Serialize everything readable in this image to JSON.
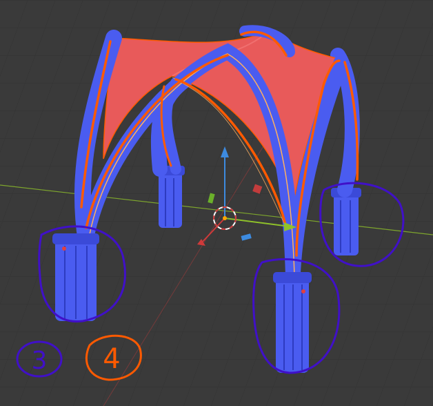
{
  "viewport": {
    "background": "#3a3a3a",
    "grid_color": "#2f2f2f"
  },
  "colors": {
    "column_blue": "#4a5cf0",
    "column_blue_dark": "#2d3bc0",
    "vault_red": "#e85a5a",
    "outline_orange": "#ff5a00",
    "edge_highlight": "#ffb060",
    "axis_x": "#8fc12a",
    "axis_y": "#c23c3c",
    "gizmo_up": "#3d8be0",
    "annotation_purple": "#4010c8",
    "annotation_orange": "#ff5a00"
  },
  "annotations": {
    "left_label": "3",
    "right_label": "4"
  },
  "icons": {
    "origin": "3d-cursor-icon",
    "gizmo": "transform-gizmo-icon"
  }
}
